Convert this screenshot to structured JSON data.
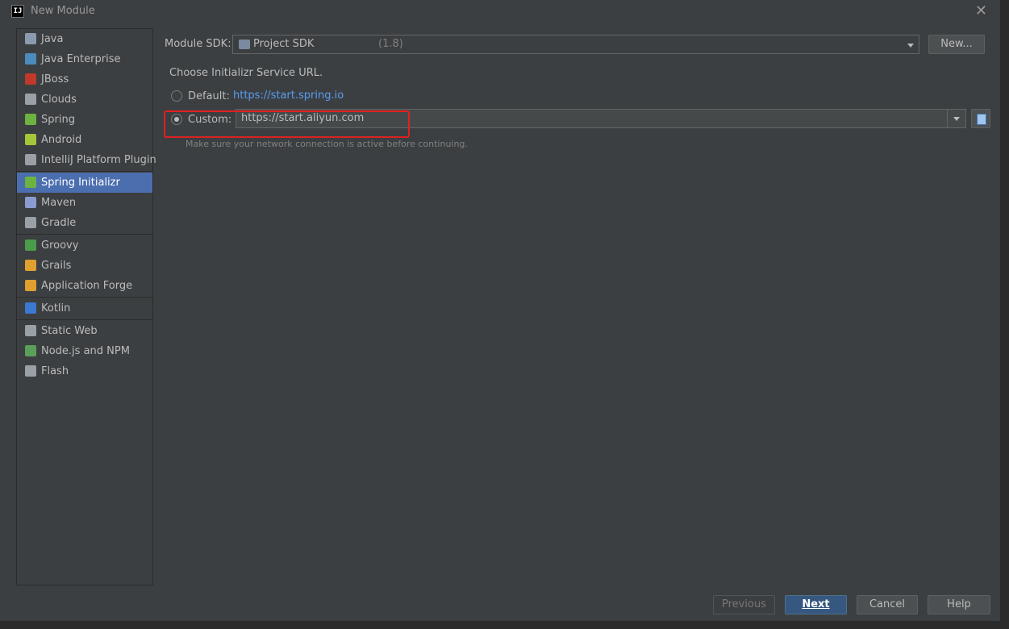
{
  "window": {
    "title": "New Module",
    "icon_label": "IJ"
  },
  "sidebar": {
    "groups": [
      [
        {
          "label": "Java",
          "icon": "folder-icon",
          "color": "#8a9bb0"
        },
        {
          "label": "Java Enterprise",
          "icon": "java-ee-icon",
          "color": "#4b8bbe"
        },
        {
          "label": "JBoss",
          "icon": "jboss-icon",
          "color": "#c0392b"
        },
        {
          "label": "Clouds",
          "icon": "cloud-icon",
          "color": "#9aa0a6"
        },
        {
          "label": "Spring",
          "icon": "spring-leaf-icon",
          "color": "#6db33f"
        },
        {
          "label": "Android",
          "icon": "android-icon",
          "color": "#a4c639"
        },
        {
          "label": "IntelliJ Platform Plugin",
          "icon": "plugin-icon",
          "color": "#9aa0a6"
        }
      ],
      [
        {
          "label": "Spring Initializr",
          "icon": "spring-initializr-icon",
          "color": "#6db33f",
          "selected": true
        },
        {
          "label": "Maven",
          "icon": "maven-icon",
          "color": "#8a9bd0"
        },
        {
          "label": "Gradle",
          "icon": "gradle-icon",
          "color": "#9aa0a6"
        }
      ],
      [
        {
          "label": "Groovy",
          "icon": "groovy-icon",
          "color": "#4a9c4a"
        },
        {
          "label": "Grails",
          "icon": "grails-icon",
          "color": "#e0a030"
        },
        {
          "label": "Application Forge",
          "icon": "forge-icon",
          "color": "#e0a030"
        }
      ],
      [
        {
          "label": "Kotlin",
          "icon": "kotlin-icon",
          "color": "#3b78d0"
        }
      ],
      [
        {
          "label": "Static Web",
          "icon": "globe-icon",
          "color": "#9aa0a6"
        },
        {
          "label": "Node.js and NPM",
          "icon": "nodejs-icon",
          "color": "#5aa05a"
        },
        {
          "label": "Flash",
          "icon": "flash-folder-icon",
          "color": "#9aa0a6"
        }
      ]
    ]
  },
  "sdk": {
    "label": "Module SDK:",
    "value": "Project SDK",
    "version": "(1.8)",
    "new_button": "New..."
  },
  "initializr": {
    "choose_label": "Choose Initializr Service URL.",
    "default_label": "Default:",
    "default_url": "https://start.spring.io",
    "custom_label": "Custom:",
    "custom_url": "https://start.aliyun.com",
    "hint": "Make sure your network connection is active before continuing."
  },
  "footer": {
    "previous": "Previous",
    "next": "Next",
    "cancel": "Cancel",
    "help": "Help"
  },
  "colors": {
    "accent": "#4b6eaf",
    "link": "#589df6",
    "highlight": "#e02020"
  }
}
